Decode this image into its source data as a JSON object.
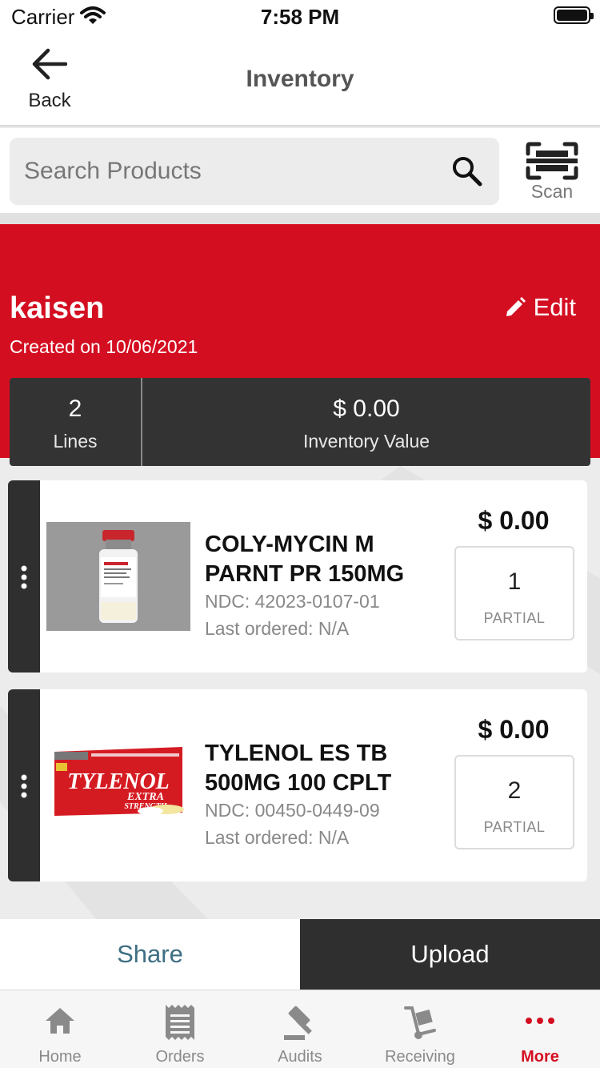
{
  "status_bar": {
    "carrier": "Carrier",
    "time": "7:58 PM"
  },
  "nav": {
    "back_label": "Back",
    "title": "Inventory"
  },
  "search": {
    "placeholder": "Search Products",
    "value": "",
    "scan_label": "Scan"
  },
  "inventory": {
    "name": "kaisen",
    "created_on": "Created on 10/06/2021",
    "edit_label": "Edit",
    "lines_count": "2",
    "lines_label": "Lines",
    "value": "$ 0.00",
    "value_label": "Inventory Value"
  },
  "products": [
    {
      "name_line1": "COLY-MYCIN M",
      "name_line2": "PARNT PR 150MG",
      "ndc": "NDC: 42023-0107-01",
      "last_ordered": "Last ordered: N/A",
      "price": "$ 0.00",
      "quantity": "1",
      "unit": "PARTIAL",
      "image_icon": "vial-image"
    },
    {
      "name_line1": "TYLENOL ES TB",
      "name_line2": "500MG 100 CPLT",
      "ndc": "NDC: 00450-0449-09",
      "last_ordered": "Last ordered: N/A",
      "price": "$ 0.00",
      "quantity": "2",
      "unit": "PARTIAL",
      "image_icon": "tylenol-box-image",
      "image_text": {
        "brand": "TYLENOL",
        "variant": "EXTRA",
        "strength": "STRENGTH"
      }
    }
  ],
  "actions": {
    "share_label": "Share",
    "upload_label": "Upload"
  },
  "tabs": [
    {
      "label": "Home",
      "icon": "home-icon",
      "active": false
    },
    {
      "label": "Orders",
      "icon": "receipt-icon",
      "active": false
    },
    {
      "label": "Audits",
      "icon": "gavel-icon",
      "active": false
    },
    {
      "label": "Receiving",
      "icon": "hand-truck-icon",
      "active": false
    },
    {
      "label": "More",
      "icon": "more-dots-icon",
      "active": true
    }
  ],
  "colors": {
    "brand_red": "#d40e21",
    "dark": "#2f2f2f",
    "share_text": "#3e6e84"
  }
}
